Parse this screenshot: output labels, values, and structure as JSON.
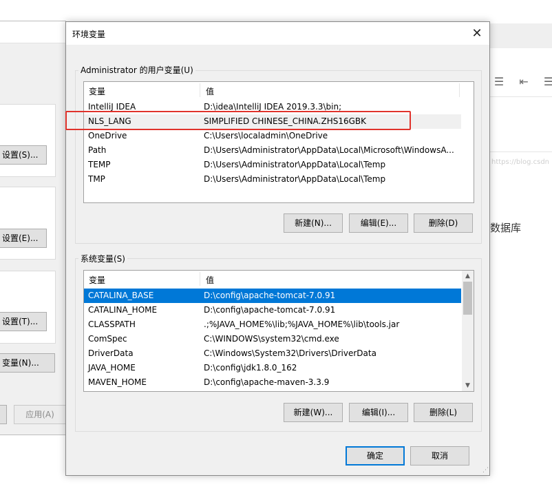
{
  "background_page": {
    "watermark": "https://blog.csdn",
    "text": "数据库"
  },
  "back_dialog": {
    "buttons": [
      "设置(S)...",
      "设置(E)...",
      "设置(T)...",
      "变量(N)..."
    ],
    "apply_label": "应用(A)"
  },
  "dialog": {
    "title": "环境变量",
    "close_glyph": "✕",
    "user_vars": {
      "label": "Administrator 的用户变量(U)",
      "col_name": "变量",
      "col_value": "值",
      "rows": [
        {
          "name": "IntelliJ IDEA",
          "value": "D:\\idea\\IntelliJ IDEA 2019.3.3\\bin;"
        },
        {
          "name": "NLS_LANG",
          "value": "SIMPLIFIED CHINESE_CHINA.ZHS16GBK"
        },
        {
          "name": "OneDrive",
          "value": "C:\\Users\\localadmin\\OneDrive"
        },
        {
          "name": "Path",
          "value": "D:\\Users\\Administrator\\AppData\\Local\\Microsoft\\WindowsA..."
        },
        {
          "name": "TEMP",
          "value": "D:\\Users\\Administrator\\AppData\\Local\\Temp"
        },
        {
          "name": "TMP",
          "value": "D:\\Users\\Administrator\\AppData\\Local\\Temp"
        }
      ],
      "new_label": "新建(N)...",
      "edit_label": "编辑(E)...",
      "delete_label": "删除(D)"
    },
    "system_vars": {
      "label": "系统变量(S)",
      "col_name": "变量",
      "col_value": "值",
      "rows": [
        {
          "name": "CATALINA_BASE",
          "value": "D:\\config\\apache-tomcat-7.0.91"
        },
        {
          "name": "CATALINA_HOME",
          "value": "D:\\config\\apache-tomcat-7.0.91"
        },
        {
          "name": "CLASSPATH",
          "value": ".;%JAVA_HOME%\\lib;%JAVA_HOME%\\lib\\tools.jar"
        },
        {
          "name": "ComSpec",
          "value": "C:\\WINDOWS\\system32\\cmd.exe"
        },
        {
          "name": "DriverData",
          "value": "C:\\Windows\\System32\\Drivers\\DriverData"
        },
        {
          "name": "JAVA_HOME",
          "value": "D:\\config\\jdk1.8.0_162"
        },
        {
          "name": "MAVEN_HOME",
          "value": "D:\\config\\apache-maven-3.3.9"
        }
      ],
      "new_label": "新建(W)...",
      "edit_label": "编辑(I)...",
      "delete_label": "删除(L)"
    },
    "ok_label": "确定",
    "cancel_label": "取消"
  },
  "colors": {
    "selection": "#0078d7",
    "highlight_box": "#e0322b"
  }
}
